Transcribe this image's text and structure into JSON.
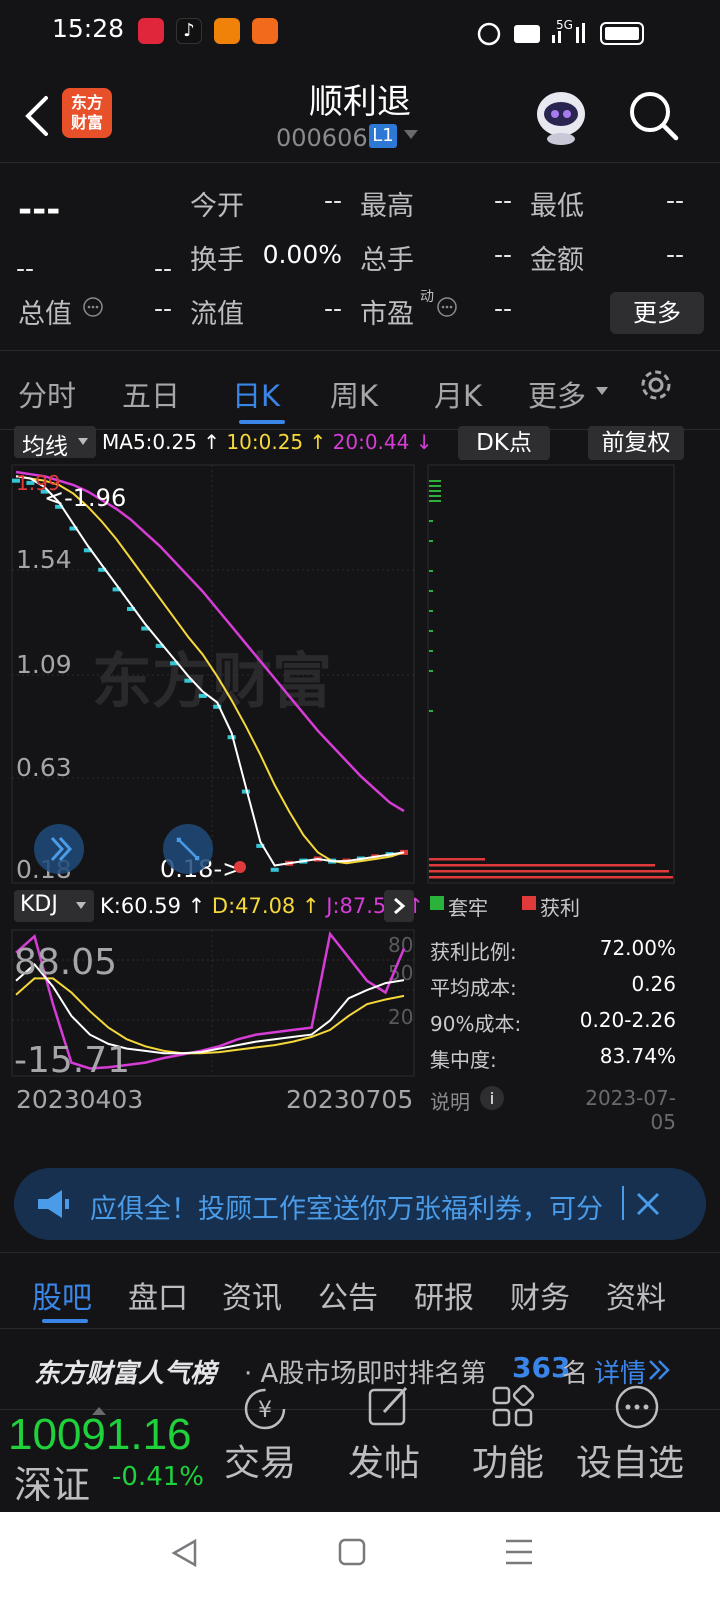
{
  "status_bar": {
    "time": "15:28",
    "network": "5G"
  },
  "header": {
    "logo_text": "东方财富",
    "title": "顺利退",
    "code": "000606",
    "level_badge": "L1"
  },
  "quote": {
    "price": "---",
    "change_left": "--",
    "change_right": "--",
    "cells": [
      {
        "label": "今开",
        "value": "--"
      },
      {
        "label": "最高",
        "value": "--"
      },
      {
        "label": "最低",
        "value": "--"
      },
      {
        "label": "换手",
        "value": "0.00%"
      },
      {
        "label": "总手",
        "value": "--"
      },
      {
        "label": "金额",
        "value": "--"
      },
      {
        "label": "总值",
        "value": "--"
      },
      {
        "label": "流值",
        "value": "--"
      },
      {
        "label": "市盈",
        "value": "--"
      }
    ],
    "pe_superscript": "动",
    "more_button": "更多"
  },
  "period_tabs": [
    "分时",
    "五日",
    "日K",
    "周K",
    "月K",
    "更多"
  ],
  "active_period": "日K",
  "chart_header": {
    "indicator_select": "均线",
    "ma5": "MA5:0.25",
    "ma10": "10:0.25",
    "ma20": "20:0.44",
    "dk_button": "DK点",
    "adjust_button": "前复权"
  },
  "colors": {
    "ma5": "#ffffff",
    "ma10": "#f5d83a",
    "ma20": "#d63cd6",
    "up": "#e03a3a",
    "down": "#34c6d4",
    "profit": "#e03a3a",
    "trapped": "#2ab23a",
    "accent": "#3a86e8"
  },
  "chart_data": [
    {
      "type": "line",
      "name": "kline",
      "y_ticks": [
        "1.54",
        "1.09",
        "0.63",
        "0.18"
      ],
      "top_label": "1.99",
      "max_annotation": "<-1.96",
      "min_annotation": "0.18->",
      "watermark": "东方财富",
      "ma5": [
        1.98,
        1.97,
        1.93,
        1.86,
        1.76,
        1.66,
        1.57,
        1.48,
        1.39,
        1.3,
        1.22,
        1.14,
        1.06,
        0.99,
        0.94,
        0.8,
        0.55,
        0.3,
        0.19,
        0.2,
        0.21,
        0.22,
        0.21,
        0.21,
        0.22,
        0.23,
        0.24,
        0.25
      ],
      "ma10": [
        1.98,
        1.97,
        1.96,
        1.94,
        1.9,
        1.84,
        1.77,
        1.69,
        1.6,
        1.51,
        1.42,
        1.33,
        1.24,
        1.16,
        1.06,
        0.95,
        0.83,
        0.7,
        0.56,
        0.44,
        0.33,
        0.25,
        0.21,
        0.2,
        0.21,
        0.22,
        0.23,
        0.25
      ],
      "ma20": [
        2.0,
        1.99,
        1.98,
        1.96,
        1.94,
        1.91,
        1.87,
        1.83,
        1.78,
        1.72,
        1.66,
        1.59,
        1.52,
        1.45,
        1.37,
        1.29,
        1.21,
        1.13,
        1.05,
        0.97,
        0.89,
        0.81,
        0.74,
        0.67,
        0.6,
        0.54,
        0.48,
        0.44
      ]
    },
    {
      "type": "line",
      "name": "kdj",
      "k": [
        60,
        74,
        55,
        30,
        14,
        6,
        2,
        0,
        -2,
        -2,
        -1,
        2,
        5,
        8,
        10,
        12,
        14,
        26,
        45,
        52,
        58,
        60.59
      ],
      "d": [
        48,
        62,
        62,
        50,
        34,
        20,
        10,
        4,
        0,
        -2,
        -2,
        -1,
        1,
        3,
        5,
        8,
        12,
        18,
        30,
        40,
        44,
        47.08
      ],
      "j": [
        84,
        98,
        40,
        -10,
        -15,
        -14,
        -12,
        -10,
        -6,
        -3,
        0,
        4,
        10,
        14,
        16,
        18,
        20,
        100,
        80,
        60,
        50,
        87.59
      ],
      "top_value": "88.05",
      "bottom_value": "-15.71",
      "right_ticks": [
        "80",
        "50",
        "20"
      ]
    }
  ],
  "kdj_header": {
    "select": "KDJ",
    "k": "K:60.59",
    "d": "D:47.08",
    "j": "J:87.59"
  },
  "x_labels": {
    "start": "20230403",
    "end": "20230705"
  },
  "chip_panel": {
    "legend_trapped": "套牢",
    "legend_profit": "获利",
    "rows": [
      {
        "label": "获利比例:",
        "value": "72.00%"
      },
      {
        "label": "平均成本:",
        "value": "0.26"
      },
      {
        "label": "90%成本:",
        "value": "0.20-2.26"
      },
      {
        "label": "集中度:",
        "value": "83.74%"
      }
    ],
    "note_label": "说明",
    "date": "2023-07-05"
  },
  "banner": {
    "text": "应俱全！投顾工作室送你万张福利券，可分"
  },
  "section_tabs": [
    "股吧",
    "盘口",
    "资讯",
    "公告",
    "研报",
    "财务",
    "资料"
  ],
  "active_section": "股吧",
  "popularity": {
    "brand": "东方财富人气榜",
    "text": "· A股市场即时排名第",
    "rank": "363",
    "suffix": "名",
    "link": "详情"
  },
  "toolbar": {
    "index_value": "10091.16",
    "index_name": "深证",
    "index_change": "-0.41%",
    "items": [
      "交易",
      "发帖",
      "功能",
      "设自选"
    ]
  }
}
